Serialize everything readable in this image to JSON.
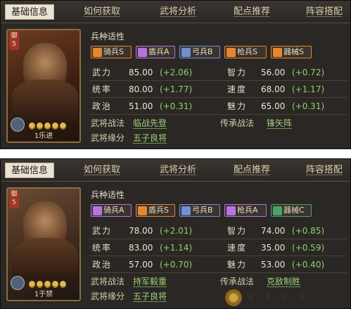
{
  "tabs": [
    "基础信息",
    "如何获取",
    "武将分析",
    "配点推荐",
    "阵容搭配"
  ],
  "section_title": "兵种适性",
  "stat_labels": [
    "武力",
    "智力",
    "统率",
    "速度",
    "政治",
    "魅力"
  ],
  "tactic_labels": [
    "武将战法",
    "传承战法",
    "武将缘分"
  ],
  "troop_colors": {
    "S": "#e7852d",
    "A": "#b774e0",
    "B": "#6f8fd6",
    "C": "#4aa36a"
  },
  "panels": [
    {
      "cost": "御\n5",
      "portrait_caption": "1乐进",
      "stars": 5,
      "troops": [
        {
          "name": "骑兵S",
          "icon": "horse-icon",
          "grade": "S"
        },
        {
          "name": "盾兵A",
          "icon": "shield-icon",
          "grade": "A"
        },
        {
          "name": "弓兵B",
          "icon": "bow-icon",
          "grade": "B"
        },
        {
          "name": "枪兵S",
          "icon": "spear-icon",
          "grade": "S"
        },
        {
          "name": "器械S",
          "icon": "siege-icon",
          "grade": "S"
        }
      ],
      "stats": [
        {
          "v": "85.00",
          "inc": "(+2.06)"
        },
        {
          "v": "56.00",
          "inc": "(+0.72)"
        },
        {
          "v": "80.00",
          "inc": "(+1.77)"
        },
        {
          "v": "68.00",
          "inc": "(+1.17)"
        },
        {
          "v": "51.00",
          "inc": "(+0.31)"
        },
        {
          "v": "65.00",
          "inc": "(+0.31)"
        }
      ],
      "tactic": "临战先登",
      "inherited": "锋矢阵",
      "bond": "五子良将"
    },
    {
      "cost": "御\n5",
      "portrait_caption": "1于禁",
      "stars": 5,
      "troops": [
        {
          "name": "骑兵A",
          "icon": "horse-icon",
          "grade": "A"
        },
        {
          "name": "盾兵S",
          "icon": "shield-icon",
          "grade": "S"
        },
        {
          "name": "弓兵B",
          "icon": "bow-icon",
          "grade": "B"
        },
        {
          "name": "枪兵A",
          "icon": "spear-icon",
          "grade": "A"
        },
        {
          "name": "器械C",
          "icon": "siege-icon",
          "grade": "C"
        }
      ],
      "stats": [
        {
          "v": "78.00",
          "inc": "(+2.01)"
        },
        {
          "v": "74.00",
          "inc": "(+0.85)"
        },
        {
          "v": "83.00",
          "inc": "(+1.14)"
        },
        {
          "v": "35.00",
          "inc": "(+0.59)"
        },
        {
          "v": "57.00",
          "inc": "(+0.70)"
        },
        {
          "v": "53.00",
          "inc": "(+0.40)"
        }
      ],
      "tactic": "持军毅重",
      "inherited": "克敌制胜",
      "bond": "五子良将"
    }
  ]
}
